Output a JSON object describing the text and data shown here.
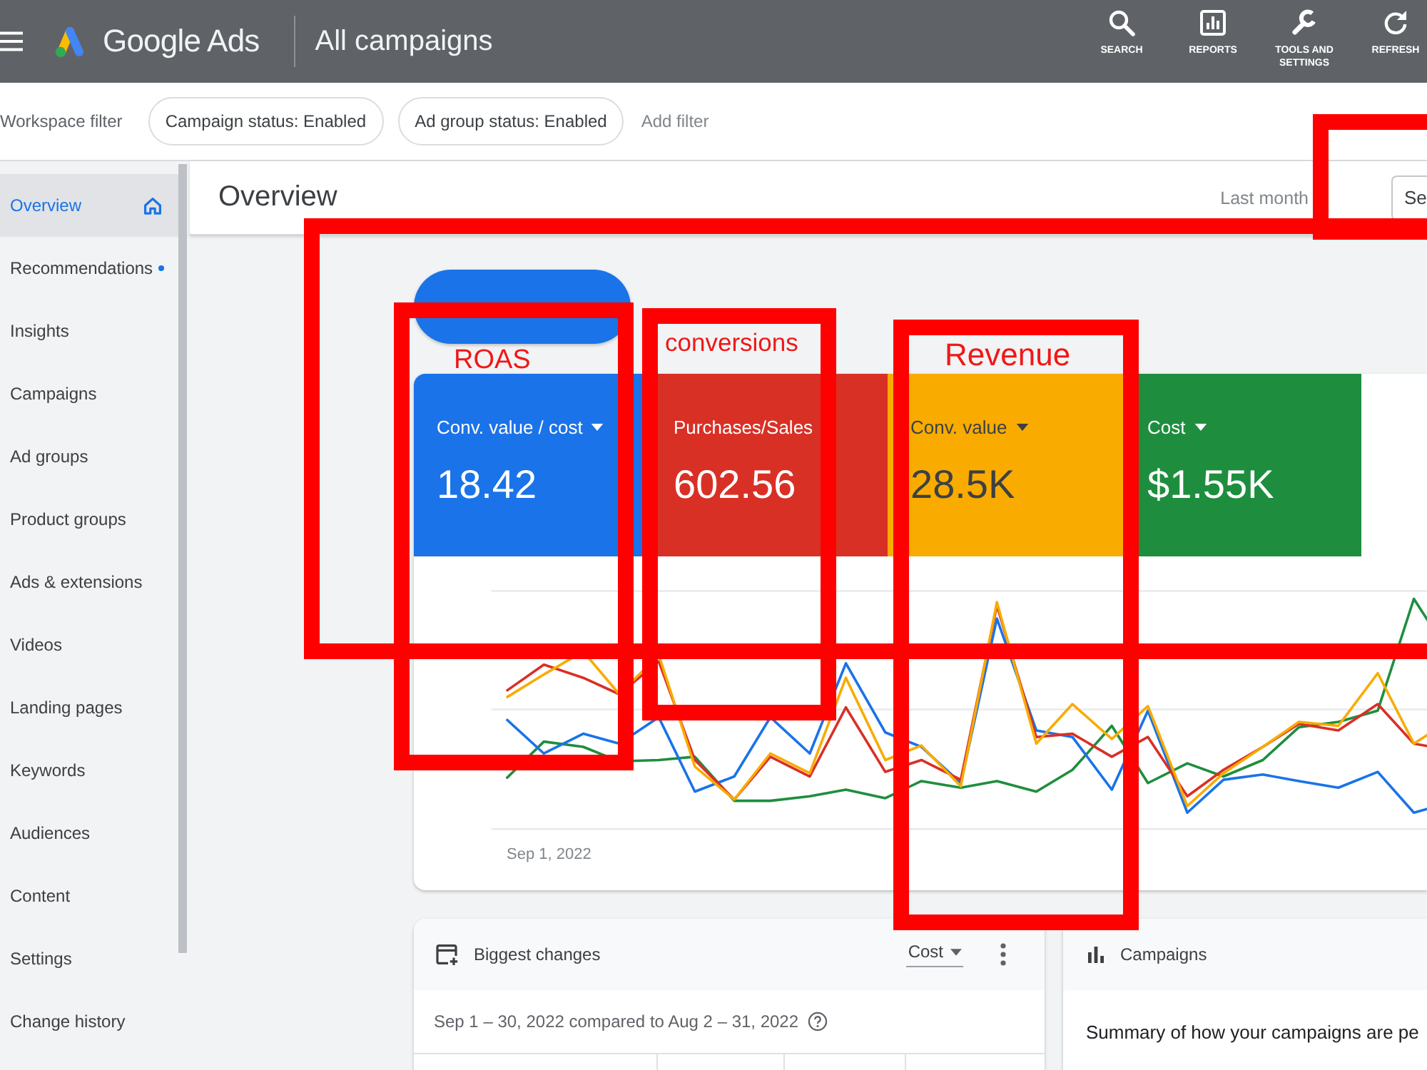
{
  "top_bar": {
    "product": "Google Ads",
    "title": "All campaigns",
    "tools": [
      {
        "kind": "search",
        "label": "SEARCH"
      },
      {
        "kind": "reports",
        "label": "REPORTS"
      },
      {
        "kind": "tools",
        "label": "TOOLS AND SETTINGS"
      },
      {
        "kind": "refresh",
        "label": "REFRESH"
      }
    ]
  },
  "filter_bar": {
    "label": "Workspace filter",
    "chips": [
      "Campaign status: Enabled",
      "Ad group status: Enabled"
    ],
    "add_filter": "Add filter"
  },
  "sidebar": {
    "items": [
      {
        "label": "Overview",
        "selected": true,
        "notification": false
      },
      {
        "label": "Recommendations",
        "selected": false,
        "notification": true
      },
      {
        "label": "Insights",
        "selected": false,
        "notification": false
      },
      {
        "label": "Campaigns",
        "selected": false,
        "notification": false
      },
      {
        "label": "Ad groups",
        "selected": false,
        "notification": false
      },
      {
        "label": "Product groups",
        "selected": false,
        "notification": false
      },
      {
        "label": "Ads & extensions",
        "selected": false,
        "notification": false
      },
      {
        "label": "Videos",
        "selected": false,
        "notification": false
      },
      {
        "label": "Landing pages",
        "selected": false,
        "notification": false
      },
      {
        "label": "Keywords",
        "selected": false,
        "notification": false
      },
      {
        "label": "Audiences",
        "selected": false,
        "notification": false
      },
      {
        "label": "Content",
        "selected": false,
        "notification": false
      },
      {
        "label": "Settings",
        "selected": false,
        "notification": false
      },
      {
        "label": "Change history",
        "selected": false,
        "notification": false
      }
    ]
  },
  "page_header": {
    "title": "Overview",
    "date_preset": "Last month",
    "date_range": "Se"
  },
  "metrics": [
    {
      "label": "Conv. value / cost",
      "value": "18.42",
      "color": "#1a73e8",
      "menu": true
    },
    {
      "label": "Purchases/Sales",
      "value": "602.56",
      "color": "#d93025",
      "menu": false
    },
    {
      "label": "Conv. value",
      "value": "28.5K",
      "color": "#f9ab00",
      "menu": true
    },
    {
      "label": "Cost",
      "value": "$1.55K",
      "color": "#1e8e3e",
      "menu": true
    }
  ],
  "chart": {
    "x_label": "Sep 1, 2022"
  },
  "biggest_changes": {
    "title": "Biggest changes",
    "metric": "Cost",
    "period": "Sep 1 – 30, 2022 compared to Aug 2 – 31, 2022"
  },
  "campaigns_card": {
    "title": "Campaigns",
    "summary": "Summary of how your campaigns are pe"
  },
  "annotations": [
    {
      "kind": "frame"
    },
    {
      "kind": "frame"
    },
    {
      "kind": "frame"
    },
    {
      "kind": "frame"
    },
    {
      "kind": "frame"
    },
    {
      "kind": "label",
      "text": "ROAS"
    },
    {
      "kind": "label",
      "text": "conversions"
    },
    {
      "kind": "label",
      "text": "Revenue"
    }
  ]
}
